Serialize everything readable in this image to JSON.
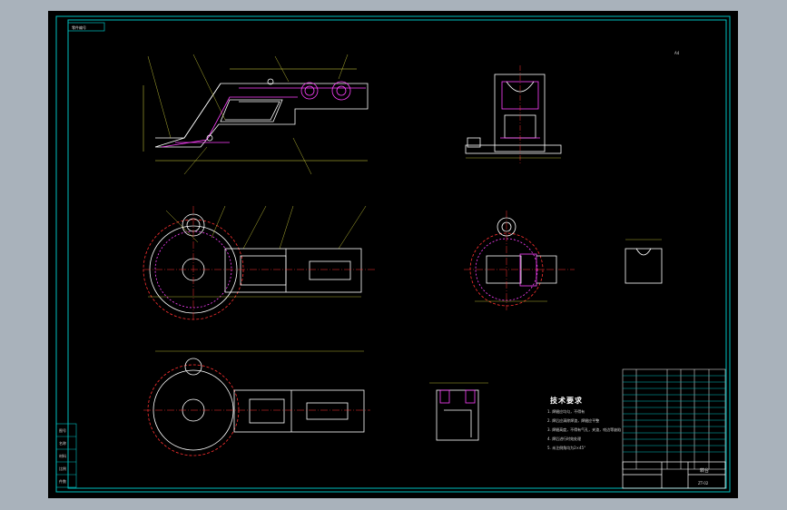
{
  "app": {
    "background_color": "#a9b2bb",
    "canvas_color": "#000000",
    "frame_color": "#00c0c0",
    "outline_color": "#ffffff",
    "detail_color": "#ff40ff",
    "centerline_color": "#ff3030",
    "leader_color": "#e0e040"
  },
  "drawing": {
    "corner_label": "零件编号",
    "corner_note": "A4",
    "tech_requirements": {
      "title": "技术要求",
      "lines": [
        "1. 焊缝应均匀，不得有",
        "2. 焊后应清除焊渣，焊缝应平整",
        "3. 焊缝高度，不得有气孔，夹渣，咬边等缺陷",
        "4. 焊后进行时效处理",
        "5. 未注倒角均为2×45°"
      ]
    },
    "title_block": {
      "name": "转台",
      "code": "ZT-02"
    },
    "left_table": [
      "图号",
      "名称",
      "材料",
      "比例",
      "件数"
    ]
  }
}
